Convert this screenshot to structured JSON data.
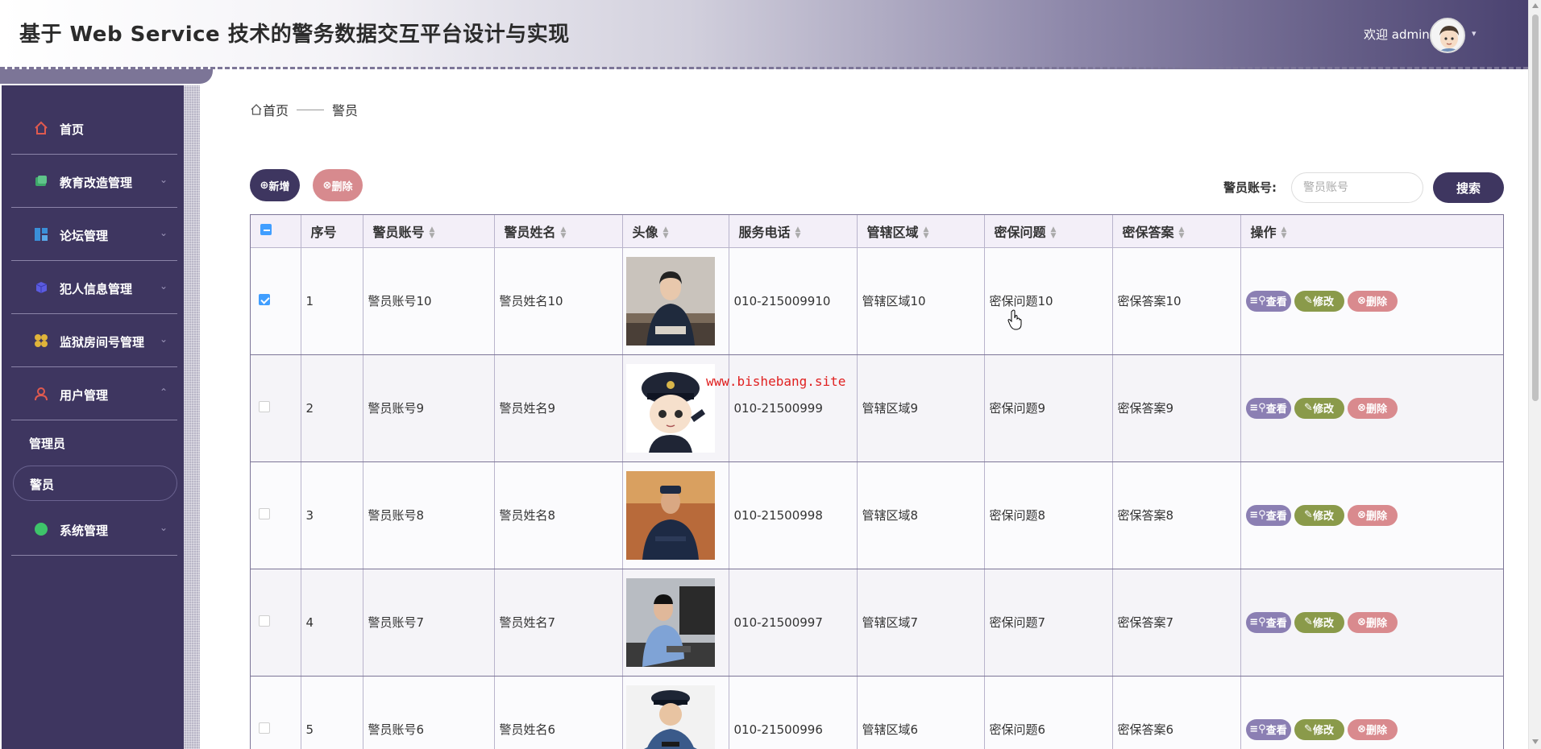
{
  "header": {
    "title": "基于 Web Service 技术的警务数据交互平台设计与实现",
    "welcome": "欢迎 admin"
  },
  "sidebar": {
    "items": [
      {
        "label": "首页",
        "icon": "home-icon",
        "color": "#e05a4f"
      },
      {
        "label": "教育改造管理",
        "icon": "book-icon",
        "color": "#3ea86a"
      },
      {
        "label": "论坛管理",
        "icon": "grid-icon",
        "color": "#3a8fd8"
      },
      {
        "label": "犯人信息管理",
        "icon": "cube-icon",
        "color": "#5b5be0"
      },
      {
        "label": "监狱房间号管理",
        "icon": "flower-icon",
        "color": "#e0b43a"
      },
      {
        "label": "用户管理",
        "icon": "user-icon",
        "color": "#e05a4f"
      },
      {
        "label": "系统管理",
        "icon": "circle-icon",
        "color": "#3ec46a"
      }
    ],
    "sub_items": [
      "管理员",
      "警员"
    ],
    "active_sub": "警员"
  },
  "breadcrumb": {
    "home": "首页",
    "current": "警员"
  },
  "toolbar": {
    "add_label": "新增",
    "delete_label": "删除",
    "search_label": "警员账号:",
    "search_placeholder": "警员账号",
    "search_button": "搜索"
  },
  "table": {
    "columns": [
      "序号",
      "警员账号",
      "警员姓名",
      "头像",
      "服务电话",
      "管辖区域",
      "密保问题",
      "密保答案",
      "操作"
    ],
    "rows": [
      {
        "index": "1",
        "account": "警员账号10",
        "name": "警员姓名10",
        "phone": "010-215009910",
        "region": "管辖区域10",
        "question": "密保问题10",
        "answer": "密保答案10",
        "checked": true
      },
      {
        "index": "2",
        "account": "警员账号9",
        "name": "警员姓名9",
        "phone": "010-21500999",
        "region": "管辖区域9",
        "question": "密保问题9",
        "answer": "密保答案9",
        "checked": false
      },
      {
        "index": "3",
        "account": "警员账号8",
        "name": "警员姓名8",
        "phone": "010-21500998",
        "region": "管辖区域8",
        "question": "密保问题8",
        "answer": "密保答案8",
        "checked": false
      },
      {
        "index": "4",
        "account": "警员账号7",
        "name": "警员姓名7",
        "phone": "010-21500997",
        "region": "管辖区域7",
        "question": "密保问题7",
        "answer": "密保答案7",
        "checked": false
      },
      {
        "index": "5",
        "account": "警员账号6",
        "name": "警员姓名6",
        "phone": "010-21500996",
        "region": "管辖区域6",
        "question": "密保问题6",
        "answer": "密保答案6",
        "checked": false
      }
    ],
    "actions": {
      "view": "查看",
      "edit": "修改",
      "delete": "删除"
    }
  },
  "watermark": "www.bishebang.site",
  "colors": {
    "primary": "#3e3660",
    "accent_view": "#8b7fb3",
    "accent_edit": "#8a9a4a",
    "accent_delete": "#d98a8e"
  }
}
